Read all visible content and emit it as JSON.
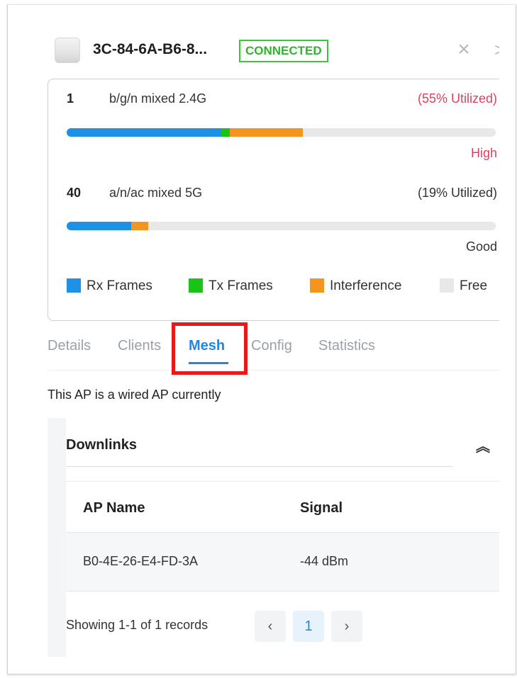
{
  "header": {
    "ap_name": "3C-84-6A-B6-8...",
    "status_badge": "CONNECTED",
    "close_glyph": "×",
    "overflow_glyph": ">"
  },
  "radios": [
    {
      "channel": "1",
      "mode": "b/g/n mixed  2.4G",
      "utilization": "(55% Utilized)",
      "quality": "High",
      "quality_color": "#e0405f",
      "utilization_color": "#e0405f",
      "segments": {
        "rx": 0.36,
        "tx": 0.02,
        "interference": 0.17
      }
    },
    {
      "channel": "40",
      "mode": "a/n/ac mixed  5G",
      "utilization": "(19% Utilized)",
      "quality": "Good",
      "quality_color": "#333333",
      "utilization_color": "#333333",
      "segments": {
        "rx": 0.15,
        "tx": 0.0,
        "interference": 0.04
      }
    }
  ],
  "legend": [
    {
      "label": "Rx Frames",
      "color": "#1e90e8"
    },
    {
      "label": "Tx Frames",
      "color": "#19c419"
    },
    {
      "label": "Interference",
      "color": "#f5941e"
    },
    {
      "label": "Free",
      "color": "#e8e8e8"
    }
  ],
  "tabs": [
    "Details",
    "Clients",
    "Mesh",
    "Config",
    "Statistics"
  ],
  "active_tab": "Mesh",
  "wired_message": "This AP is a wired AP currently",
  "downlinks": {
    "title": "Downlinks",
    "collapse_glyph": "︽",
    "columns": [
      "AP Name",
      "Signal"
    ],
    "rows": [
      {
        "ap_name": "B0-4E-26-E4-FD-3A",
        "signal": "-44 dBm"
      }
    ],
    "pager": {
      "summary": "Showing 1-1 of 1 records",
      "prev": "‹",
      "page": "1",
      "next": "›"
    }
  },
  "colors": {
    "accent": "#1f87e5",
    "connected": "#2fb52f",
    "highlight": "#e51a1a"
  }
}
